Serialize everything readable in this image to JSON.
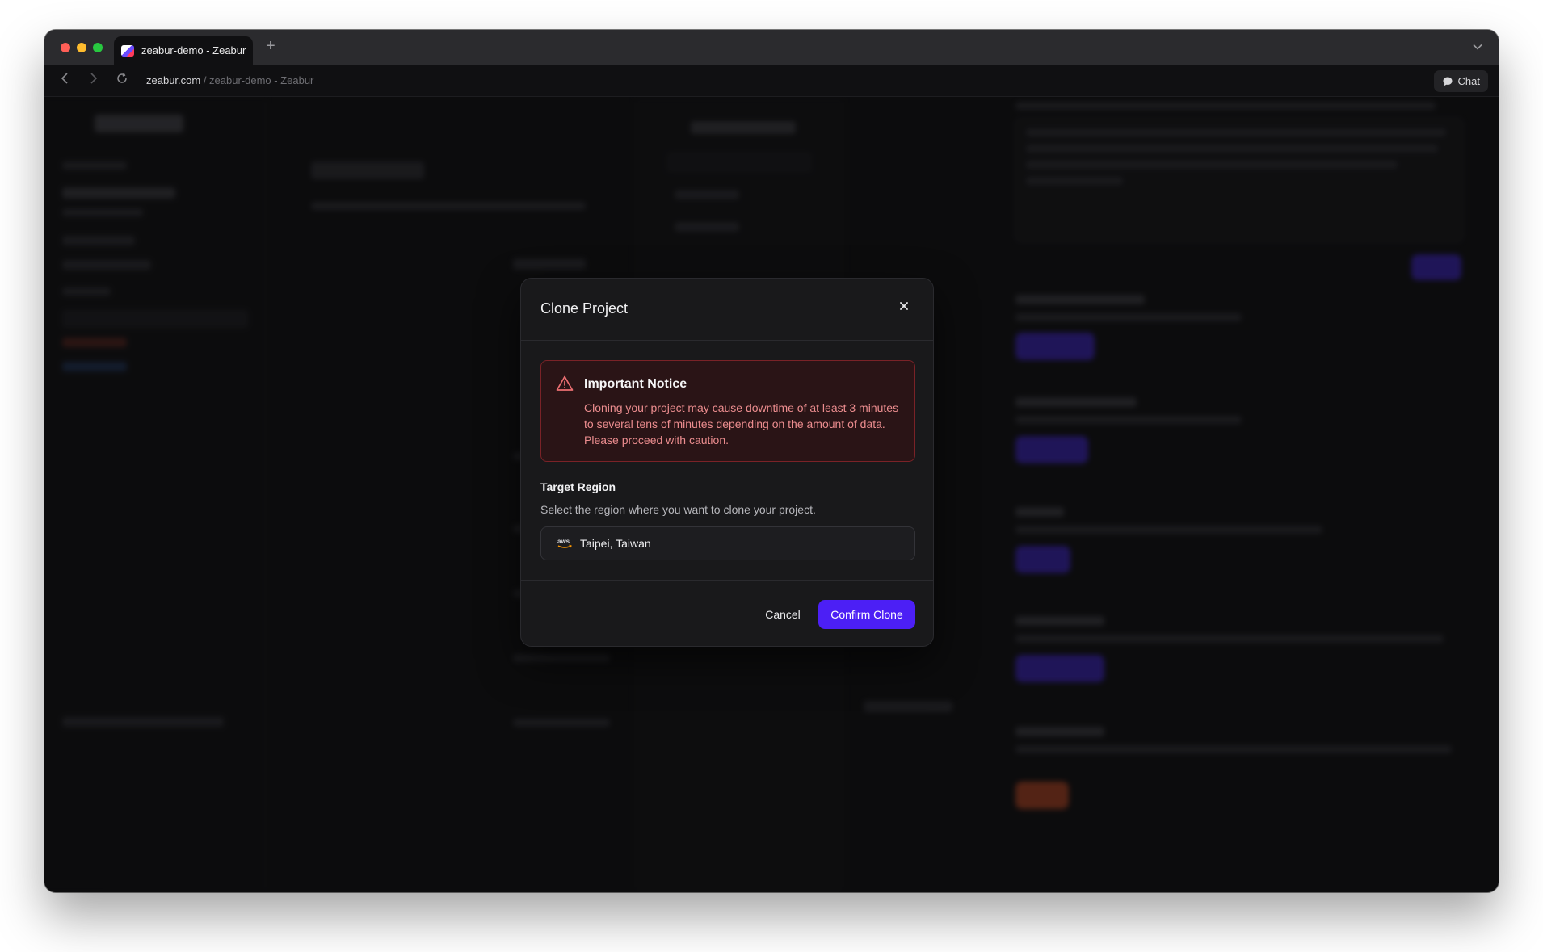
{
  "browser": {
    "tab_title": "zeabur-demo - Zeabur",
    "new_tab_symbol": "+",
    "url_domain": "zeabur.com",
    "url_path": " / zeabur-demo - Zeabur",
    "chat_label": "Chat"
  },
  "modal": {
    "title": "Clone Project",
    "notice": {
      "title": "Important Notice",
      "body": "Cloning your project may cause downtime of at least 3 minutes to several tens of minutes depending on the amount of data. Please proceed with caution."
    },
    "target_region": {
      "label": "Target Region",
      "help": "Select the region where you want to clone your project.",
      "value": "Taipei, Taiwan",
      "provider_icon": "aws-icon"
    },
    "cancel_label": "Cancel",
    "confirm_label": "Confirm Clone"
  },
  "colors": {
    "accent": "#4c1ff5",
    "danger_border": "#7a2227",
    "danger_text": "#ec8d8f",
    "modal_bg": "#19191b"
  }
}
